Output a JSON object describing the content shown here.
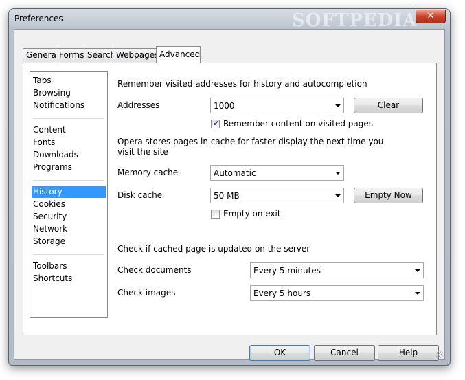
{
  "window": {
    "title": "Preferences",
    "watermark": "SOFTPEDIA",
    "close_glyph": "✕"
  },
  "tabs": [
    {
      "label": "General"
    },
    {
      "label": "Forms"
    },
    {
      "label": "Search"
    },
    {
      "label": "Webpages"
    },
    {
      "label": "Advanced",
      "active": true
    }
  ],
  "sidebar": {
    "groups": [
      [
        "Tabs",
        "Browsing",
        "Notifications"
      ],
      [
        "Content",
        "Fonts",
        "Downloads",
        "Programs"
      ],
      [
        "History",
        "Cookies",
        "Security",
        "Network",
        "Storage"
      ],
      [
        "Toolbars",
        "Shortcuts"
      ]
    ],
    "selected": "History"
  },
  "history": {
    "remember_heading": "Remember visited addresses for history and autocompletion",
    "addresses_label": "Addresses",
    "addresses_value": "1000",
    "clear_label": "Clear",
    "remember_content_label": "Remember content on visited pages",
    "remember_content_checked": true,
    "cache_note": "Opera stores pages in cache for faster display the next time you visit the site",
    "memory_cache_label": "Memory cache",
    "memory_cache_value": "Automatic",
    "disk_cache_label": "Disk cache",
    "disk_cache_value": "50 MB",
    "empty_now_label": "Empty Now",
    "empty_on_exit_label": "Empty on exit",
    "empty_on_exit_checked": false,
    "check_heading": "Check if cached page is updated on the server",
    "check_documents_label": "Check documents",
    "check_documents_value": "Every 5 minutes",
    "check_images_label": "Check images",
    "check_images_value": "Every 5 hours"
  },
  "footer": {
    "ok_label": "OK",
    "cancel_label": "Cancel",
    "help_label": "Help"
  }
}
